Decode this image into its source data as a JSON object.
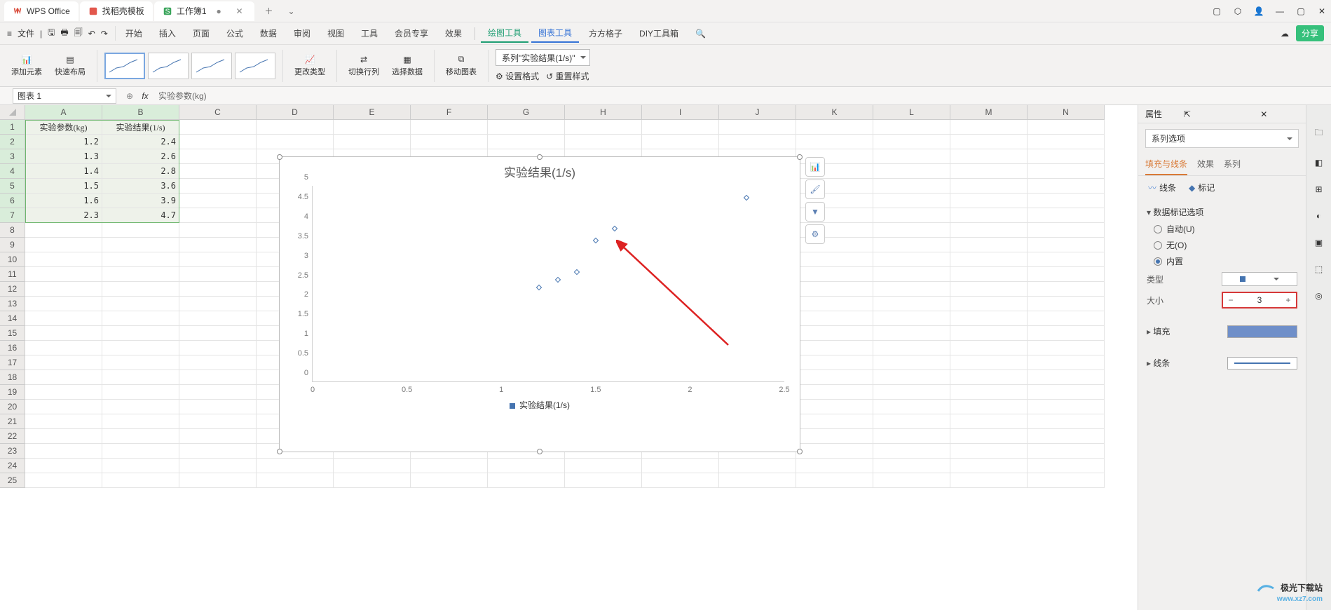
{
  "titlebar": {
    "wps": "WPS Office",
    "find": "找稻壳模板",
    "doc": "工作簿1"
  },
  "menu": {
    "file": "文件",
    "items": [
      "开始",
      "插入",
      "页面",
      "公式",
      "数据",
      "审阅",
      "视图",
      "工具",
      "会员专享",
      "效果",
      "绘图工具",
      "图表工具",
      "方方格子",
      "DIY工具箱"
    ],
    "active_green": "绘图工具",
    "active_blue": "图表工具",
    "share": "分享"
  },
  "ribbon": {
    "add_element": "添加元素",
    "quick_layout": "快速布局",
    "change_type": "更改类型",
    "switch_rowcol": "切换行列",
    "select_data": "选择数据",
    "move_chart": "移动图表",
    "series_dropdown": "系列\"实验结果(1/s)\"",
    "set_format": "设置格式",
    "reset_style": "重置样式"
  },
  "formula_bar": {
    "name_box": "图表 1",
    "formula": "实验参数(kg)"
  },
  "grid": {
    "cols": [
      "A",
      "B",
      "C",
      "D",
      "E",
      "F",
      "G",
      "H",
      "I",
      "J",
      "K",
      "L",
      "M",
      "N"
    ],
    "rows": 25,
    "headers": [
      "实验参数(kg)",
      "实验结果(1/s)"
    ],
    "data": [
      [
        1.2,
        2.4
      ],
      [
        1.3,
        2.6
      ],
      [
        1.4,
        2.8
      ],
      [
        1.5,
        3.6
      ],
      [
        1.6,
        3.9
      ],
      [
        2.3,
        4.7
      ]
    ]
  },
  "chart_data": {
    "type": "scatter",
    "title": "实验结果(1/s)",
    "x": [
      1.2,
      1.3,
      1.4,
      1.5,
      1.6,
      2.3
    ],
    "y": [
      2.4,
      2.6,
      2.8,
      3.6,
      3.9,
      4.7
    ],
    "xlabel": "",
    "ylabel": "",
    "xlim": [
      0,
      2.5
    ],
    "ylim": [
      0,
      5
    ],
    "xticks": [
      0,
      0.5,
      1,
      1.5,
      2,
      2.5
    ],
    "yticks": [
      0,
      0.5,
      1,
      1.5,
      2,
      2.5,
      3,
      3.5,
      4,
      4.5,
      5
    ],
    "legend": "实验结果(1/s)"
  },
  "panel": {
    "header": "属性",
    "series_opt": "系列选项",
    "tabs": [
      "填充与线条",
      "效果",
      "系列"
    ],
    "line": "线条",
    "marker": "标记",
    "marker_options": "数据标记选项",
    "radios": {
      "auto": "自动(U)",
      "none": "无(O)",
      "builtin": "内置"
    },
    "type": "类型",
    "size": "大小",
    "size_val": "3",
    "fill": "填充",
    "line2": "线条"
  },
  "watermark": {
    "name": "极光下载站",
    "url": "www.xz7.com"
  }
}
